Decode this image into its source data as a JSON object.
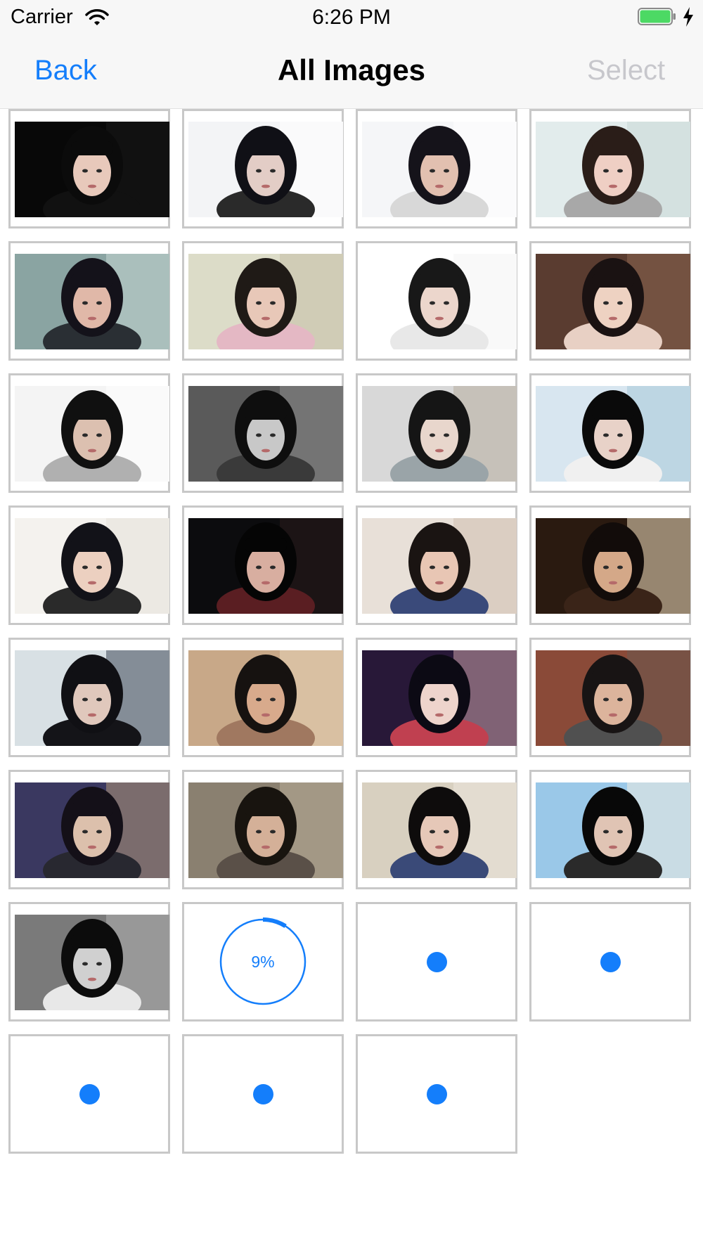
{
  "status_bar": {
    "carrier": "Carrier",
    "time": "6:26 PM",
    "wifi_icon": "wifi-icon",
    "battery_icon": "battery-icon",
    "charging_icon": "lightning-bolt-icon",
    "battery_color": "#4cd964"
  },
  "navbar": {
    "back_label": "Back",
    "title": "All Images",
    "select_label": "Select",
    "accent_color": "#147efb",
    "disabled_color": "#c7c7cc"
  },
  "grid": {
    "columns": 4,
    "items": [
      {
        "state": "loaded",
        "photo": {
          "bg": "#080808",
          "bg2": "#1a1a1a",
          "hair": "#0b0b0b",
          "skin": "#e8c9bb",
          "cloth": "#111111"
        }
      },
      {
        "state": "loaded",
        "photo": {
          "bg": "#f3f4f6",
          "bg2": "#ffffff",
          "hair": "#101016",
          "skin": "#e3cdc6",
          "cloth": "#2a2a2a"
        }
      },
      {
        "state": "loaded",
        "photo": {
          "bg": "#f5f6f8",
          "bg2": "#ffffff",
          "hair": "#15131a",
          "skin": "#e2c0b0",
          "cloth": "#d8d8d8"
        }
      },
      {
        "state": "loaded",
        "photo": {
          "bg": "#e2ecec",
          "bg2": "#c9d9d7",
          "hair": "#2a1d18",
          "skin": "#efcfc4",
          "cloth": "#a8a8a8"
        }
      },
      {
        "state": "loaded",
        "photo": {
          "bg": "#8aa4a2",
          "bg2": "#c5d5d1",
          "hair": "#14121a",
          "skin": "#e0b8a8",
          "cloth": "#2a2f34"
        }
      },
      {
        "state": "loaded",
        "photo": {
          "bg": "#dcdcc8",
          "bg2": "#c7c0a8",
          "hair": "#1f1a16",
          "skin": "#e8c8b8",
          "cloth": "#e4b8c4"
        }
      },
      {
        "state": "loaded",
        "photo": {
          "bg": "#ffffff",
          "bg2": "#f4f4f4",
          "hair": "#181818",
          "skin": "#ecd6cc",
          "cloth": "#e8e8e8"
        }
      },
      {
        "state": "loaded",
        "photo": {
          "bg": "#5a3c30",
          "bg2": "#8a6450",
          "hair": "#1a1212",
          "skin": "#eed2c2",
          "cloth": "#e8d0c4"
        }
      },
      {
        "state": "loaded",
        "photo": {
          "bg": "#f4f4f4",
          "bg2": "#ffffff",
          "hair": "#101010",
          "skin": "#dcc0b0",
          "cloth": "#b0b0b0"
        }
      },
      {
        "state": "loaded",
        "photo": {
          "bg": "#5a5a5a",
          "bg2": "#8a8a8a",
          "hair": "#0e0e0e",
          "skin": "#c8c8c8",
          "cloth": "#3a3a3a"
        }
      },
      {
        "state": "loaded",
        "photo": {
          "bg": "#d8d8d8",
          "bg2": "#b8aea0",
          "hair": "#151515",
          "skin": "#e8d6cc",
          "cloth": "#9aa4a8"
        }
      },
      {
        "state": "loaded",
        "photo": {
          "bg": "#d8e6f0",
          "bg2": "#a8c8d8",
          "hair": "#0a0a0a",
          "skin": "#e8d2c8",
          "cloth": "#f0f0f0"
        }
      },
      {
        "state": "loaded",
        "photo": {
          "bg": "#f4f2ee",
          "bg2": "#e6e2da",
          "hair": "#121218",
          "skin": "#ecd0c0",
          "cloth": "#2a2a2a"
        }
      },
      {
        "state": "loaded",
        "photo": {
          "bg": "#0c0c0e",
          "bg2": "#2a1c1c",
          "hair": "#050505",
          "skin": "#d8aea0",
          "cloth": "#5a1e22"
        }
      },
      {
        "state": "loaded",
        "photo": {
          "bg": "#e8e0d8",
          "bg2": "#cfc0b0",
          "hair": "#1a1412",
          "skin": "#e8c6b4",
          "cloth": "#3a4a7a"
        }
      },
      {
        "state": "loaded",
        "photo": {
          "bg": "#2a1a10",
          "bg2": "#f0e0c0",
          "hair": "#120c0a",
          "skin": "#d4a888",
          "cloth": "#3a2418"
        }
      },
      {
        "state": "loaded",
        "photo": {
          "bg": "#d8e0e4",
          "bg2": "#404858",
          "hair": "#101014",
          "skin": "#e0c8bc",
          "cloth": "#141418"
        }
      },
      {
        "state": "loaded",
        "photo": {
          "bg": "#c8a888",
          "bg2": "#e8d4b8",
          "hair": "#161210",
          "skin": "#d8aa8c",
          "cloth": "#a07860"
        }
      },
      {
        "state": "loaded",
        "photo": {
          "bg": "#281838",
          "bg2": "#c8a0a8",
          "hair": "#0c0a14",
          "skin": "#eed4cc",
          "cloth": "#c04050"
        }
      },
      {
        "state": "loaded",
        "photo": {
          "bg": "#8a4a38",
          "bg2": "#6a5a50",
          "hair": "#181414",
          "skin": "#dcb49c",
          "cloth": "#505050"
        }
      },
      {
        "state": "loaded",
        "photo": {
          "bg": "#3a3860",
          "bg2": "#b09878",
          "hair": "#141018",
          "skin": "#dcc0ac",
          "cloth": "#282830"
        }
      },
      {
        "state": "loaded",
        "photo": {
          "bg": "#8a8070",
          "bg2": "#b8ac98",
          "hair": "#18140f",
          "skin": "#d4b098",
          "cloth": "#5a5048"
        }
      },
      {
        "state": "loaded",
        "photo": {
          "bg": "#d8d0c0",
          "bg2": "#ece6dc",
          "hair": "#0e0c0c",
          "skin": "#e6c8b8",
          "cloth": "#3a4a78"
        }
      },
      {
        "state": "loaded",
        "photo": {
          "bg": "#9ac8e8",
          "bg2": "#f0ece0",
          "hair": "#080808",
          "skin": "#e0c4b4",
          "cloth": "#2a2a2a"
        }
      },
      {
        "state": "loaded",
        "photo": {
          "bg": "#7a7a7a",
          "bg2": "#b0b0b0",
          "hair": "#0c0c0c",
          "skin": "#d0d0d0",
          "cloth": "#e8e8e8"
        }
      },
      {
        "state": "downloading",
        "progress_value": 0.09,
        "progress_label": "9%"
      },
      {
        "state": "pending"
      },
      {
        "state": "pending"
      },
      {
        "state": "pending"
      },
      {
        "state": "pending"
      },
      {
        "state": "pending"
      }
    ]
  }
}
